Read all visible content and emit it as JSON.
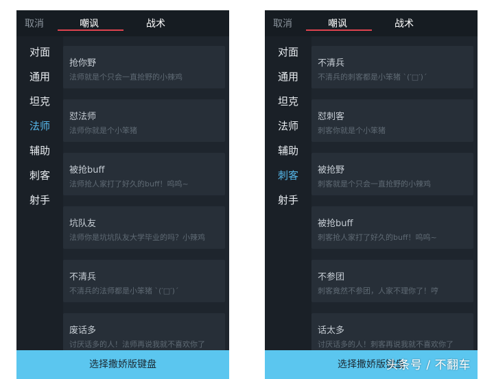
{
  "left": {
    "cancel": "取消",
    "tabs": [
      "嘲讽",
      "战术"
    ],
    "sidebar": [
      "对面",
      "通用",
      "坦克",
      "法师",
      "辅助",
      "刺客",
      "射手"
    ],
    "active_sidebar": "法师",
    "cards": [
      {
        "title": "抢你野",
        "sub": "法师就是个只会一直抢野的小辣鸡"
      },
      {
        "title": "怼法师",
        "sub": "法师你就是个小笨猪"
      },
      {
        "title": "被抢buff",
        "sub": "法师抢人家打了好久的buff！呜呜~"
      },
      {
        "title": "坑队友",
        "sub": "法师你是坑坑队友大学毕业的吗？小辣鸡"
      },
      {
        "title": "不清兵",
        "sub": "不清兵的法师都是小笨猪 ˋ(′□′)ˊ"
      },
      {
        "title": "废话多",
        "sub": "讨厌话多的人！法师再说我就不喜欢你了"
      }
    ],
    "bottom_button": "选择撒娇版键盘"
  },
  "right": {
    "cancel": "取消",
    "tabs": [
      "嘲讽",
      "战术"
    ],
    "sidebar": [
      "对面",
      "通用",
      "坦克",
      "法师",
      "辅助",
      "刺客",
      "射手"
    ],
    "active_sidebar": "刺客",
    "cards": [
      {
        "title": "不清兵",
        "sub": "不清兵的刺客都是小笨猪 ˋ(′□′)ˊ"
      },
      {
        "title": "怼刺客",
        "sub": "刺客你就是个小笨猪"
      },
      {
        "title": "被抢野",
        "sub": "刺客就是个只会一直抢野的小辣鸡"
      },
      {
        "title": "被抢buff",
        "sub": "刺客抢人家打了好久的buff！呜呜~"
      },
      {
        "title": "不参团",
        "sub": "刺客竟然不参团，人家不理你了！哼"
      },
      {
        "title": "话太多",
        "sub": "讨厌话多的人！刺客再说我就不喜欢你了"
      }
    ],
    "bottom_button": "选择撒娇版键盘"
  },
  "watermark": "头条号 / 不翻车",
  "colors": {
    "accent_active": "#56b7ea",
    "tab_underline": "#e0434f",
    "bottom_button": "#5bc6ef",
    "panel_bg": "#1e252d"
  }
}
